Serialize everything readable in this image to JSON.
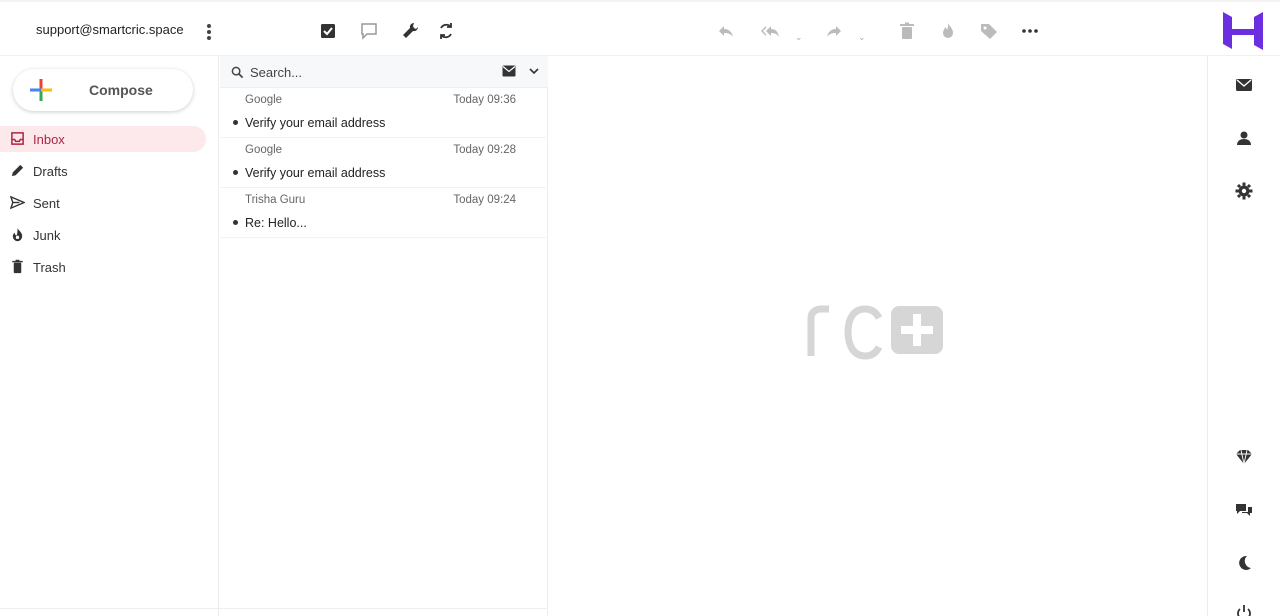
{
  "header": {
    "account": "support@smartcric.space"
  },
  "sidebar": {
    "compose_label": "Compose",
    "folders": [
      {
        "label": "Inbox",
        "icon": "inbox-icon",
        "active": true
      },
      {
        "label": "Drafts",
        "icon": "pencil-icon"
      },
      {
        "label": "Sent",
        "icon": "send-icon"
      },
      {
        "label": "Junk",
        "icon": "fire-icon"
      },
      {
        "label": "Trash",
        "icon": "trash-icon"
      }
    ]
  },
  "search": {
    "placeholder": "Search..."
  },
  "messages": [
    {
      "from": "Google",
      "date": "Today 09:36",
      "subject": "Verify your email address"
    },
    {
      "from": "Google",
      "date": "Today 09:28",
      "subject": "Verify your email address"
    },
    {
      "from": "Trisha Guru",
      "date": "Today 09:24",
      "subject": "Re: Hello..."
    }
  ],
  "colors": {
    "accent": "#b0253f",
    "active_bg": "#fde8ec",
    "brand": "#6b2fe0"
  }
}
